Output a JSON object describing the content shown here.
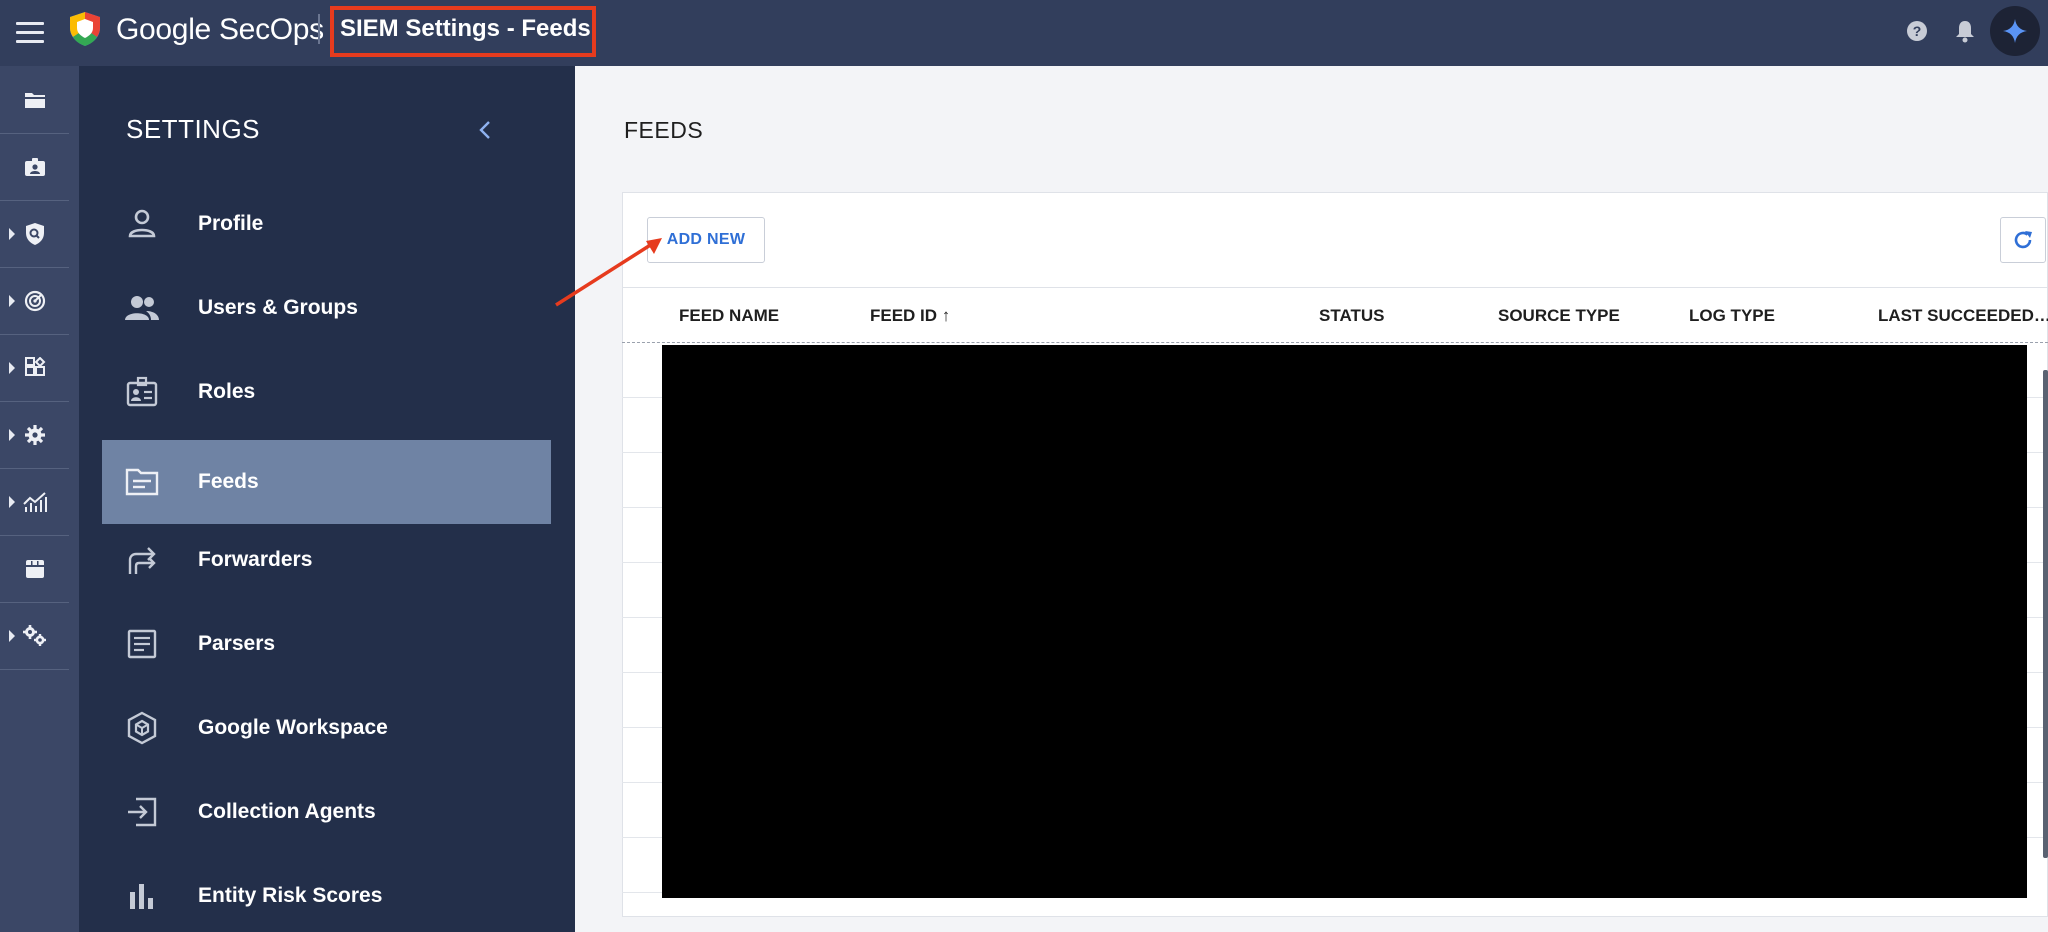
{
  "topbar": {
    "brand": "Google SecOps",
    "page_title": "SIEM Settings - Feeds",
    "icons": [
      "menu-icon",
      "help-icon",
      "bell-icon",
      "sparkle-icon"
    ]
  },
  "rail": {
    "items": [
      {
        "icon": "folder-icon",
        "expandable": false
      },
      {
        "icon": "id-badge-icon",
        "expandable": false
      },
      {
        "icon": "shield-search-icon",
        "expandable": true
      },
      {
        "icon": "radar-icon",
        "expandable": true
      },
      {
        "icon": "widgets-icon",
        "expandable": true
      },
      {
        "icon": "gear-icon",
        "expandable": true
      },
      {
        "icon": "analytics-icon",
        "expandable": true
      },
      {
        "icon": "store-icon",
        "expandable": false
      },
      {
        "icon": "gears-icon",
        "expandable": true
      }
    ]
  },
  "sidebar": {
    "title": "SETTINGS",
    "items": [
      {
        "label": "Profile",
        "icon": "person-icon",
        "active": false
      },
      {
        "label": "Users & Groups",
        "icon": "group-icon",
        "active": false
      },
      {
        "label": "Roles",
        "icon": "roles-icon",
        "active": false
      },
      {
        "label": "Feeds",
        "icon": "feeds-icon",
        "active": true
      },
      {
        "label": "Forwarders",
        "icon": "forward-icon",
        "active": false
      },
      {
        "label": "Parsers",
        "icon": "parser-icon",
        "active": false
      },
      {
        "label": "Google Workspace",
        "icon": "workspace-icon",
        "active": false
      },
      {
        "label": "Collection Agents",
        "icon": "login-icon",
        "active": false
      },
      {
        "label": "Entity Risk Scores",
        "icon": "bar-chart-icon",
        "active": false
      }
    ]
  },
  "main": {
    "title": "FEEDS",
    "add_new_label": "ADD NEW",
    "table": {
      "columns": [
        "FEED NAME",
        "FEED ID ↑",
        "STATUS",
        "SOURCE TYPE",
        "LOG TYPE",
        "LAST SUCCEEDED…"
      ]
    }
  },
  "colors": {
    "topbar": "#323e5c",
    "rail": "#3b4766",
    "sidebar": "#232f4a",
    "sidebar_active": "#6f83a4",
    "accent_blue": "#2f6fd6",
    "annotation_red": "#e63b1e"
  }
}
